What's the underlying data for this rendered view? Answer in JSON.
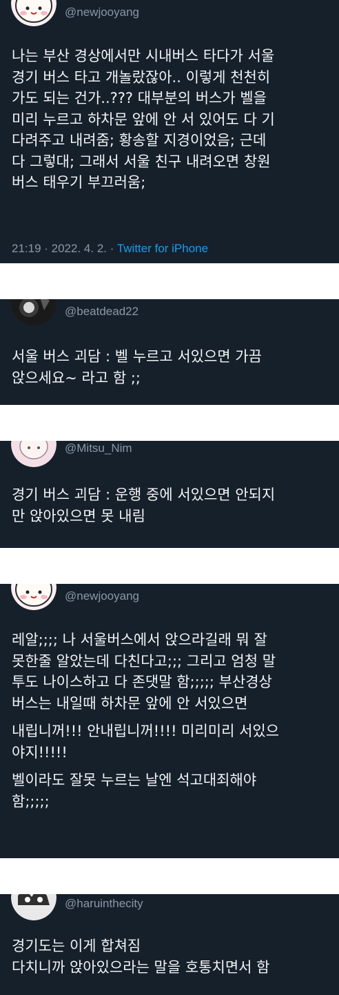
{
  "tweets": [
    {
      "handle": "@newjooyang",
      "paragraphs": [
        "나는 부산 경상에서만 시내버스 타다가 서울\n경기 버스 타고 개놀랐잖아.. 이렇게 천천히\n가도 되는 건가..??? 대부분의 버스가 벨을\n미리 누르고 하차문 앞에 안 서 있어도 다 기\n다려주고 내려줌; 황송할 지경이었음; 근데\n다 그렇대; 그래서 서울 친구 내려오면 창원\n버스 태우기 부끄러움;"
      ],
      "time": "21:19 · 2022. 4. 2. ·",
      "source": "Twitter for iPhone"
    },
    {
      "handle": "@beatdead22",
      "paragraphs": [
        "서울 버스 괴담 : 벨 누르고 서있으면 가끔\n앉으세요~ 라고 함 ;;"
      ]
    },
    {
      "handle": "@Mitsu_Nim",
      "paragraphs": [
        "경기 버스 괴담 : 운행 중에 서있으면 안되지\n만 앉아있으면 못 내림"
      ]
    },
    {
      "handle": "@newjooyang",
      "paragraphs": [
        "레알;;;; 나 서울버스에서 앉으라길래 뭐 잘\n못한줄 알았는데 다친다고;;; 그리고 엄청 말\n투도 나이스하고 다 존댓말 함;;;;; 부산경상\n버스는 내일때 하차문 앞에 안 서있으면",
        "내립니꺼!!! 안내립니꺼!!!! 미리미리 서있으\n야지!!!!!",
        "벨이라도 잘못 누르는 날엔 석고대죄해야\n함;;;;;"
      ]
    },
    {
      "handle": "@haruinthecity",
      "paragraphs": [
        "경기도는 이게 합쳐짐\n다치니까 앉아있으라는 말을 호통치면서 함"
      ]
    }
  ]
}
